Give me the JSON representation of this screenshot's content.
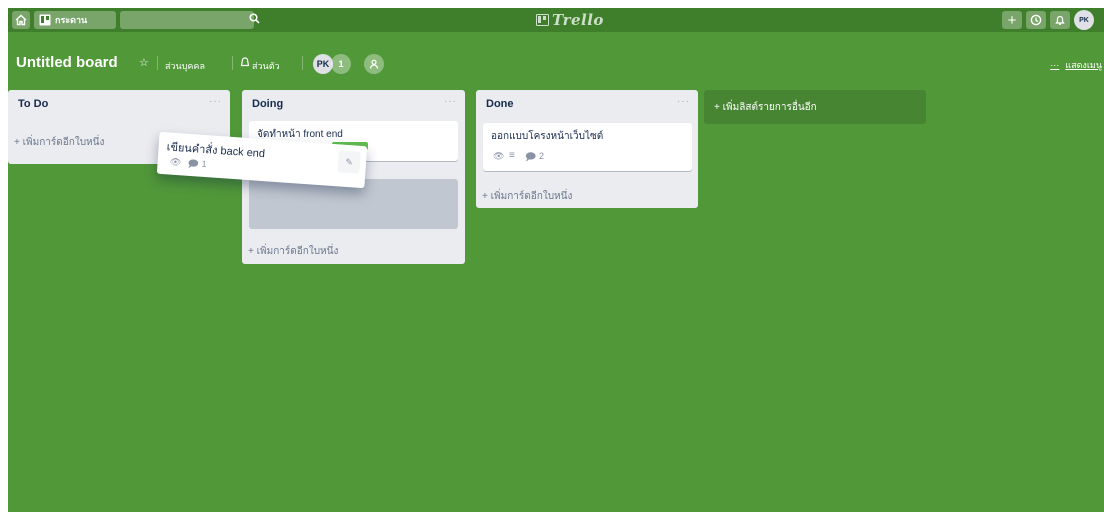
{
  "header": {
    "home_icon": "home-icon",
    "boards_label": "กระดาน",
    "boards_icon": "boards-icon",
    "search_value": "",
    "search_icon": "search-icon",
    "logo_text": "Trello",
    "add_icon": "plus-icon",
    "info_icon": "info-icon",
    "bell_icon": "bell-icon",
    "avatar_initials": "PK"
  },
  "board": {
    "title": "Untitled board",
    "star_icon": "star-icon",
    "personal_label": "ส่วนบุคคล",
    "private_icon": "lock-icon",
    "private_label": "ส่วนตัว",
    "member_initials": "PK",
    "member_count": "1",
    "invite_icon": "invite-icon",
    "show_menu_label": "แสดงเมนู",
    "show_menu_icon": "ellipsis-icon"
  },
  "lists": [
    {
      "title": "To Do",
      "menu": "···",
      "add_card": "+ เพิ่มการ์ดอีกใบหนึ่ง"
    },
    {
      "title": "Doing",
      "menu": "···",
      "card_title": "จัดทำหน้า front end",
      "add_card": "+ เพิ่มการ์ดอีกใบหนึ่ง"
    },
    {
      "title": "Done",
      "menu": "···",
      "card_title": "ออกแบบโครงหน้าเว็บไซต์",
      "card_comments": "2",
      "add_card": "+ เพิ่มการ์ดอีกใบหนึ่ง"
    }
  ],
  "add_list_label": "+ เพิ่มลิสต์รายการอื่นอีก",
  "dragging_card": {
    "title": "เขียนคำสั่ง back end",
    "comments": "1"
  },
  "colors": {
    "board_bg": "#519839",
    "header_bg": "#3f7f2b",
    "list_bg": "#ebecf0",
    "label_green": "#61bd4f"
  }
}
